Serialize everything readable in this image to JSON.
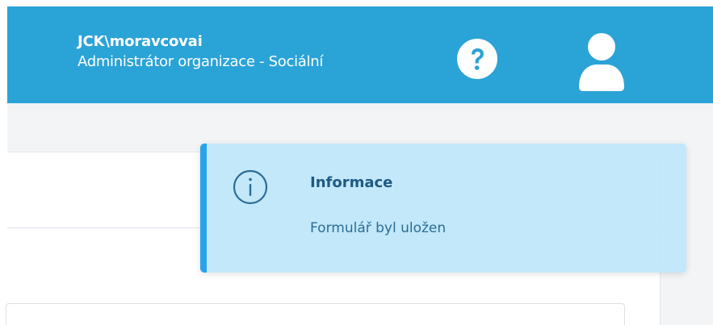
{
  "header": {
    "username": "JCK\\moravcovai",
    "role": "Administrátor organizace - Sociální",
    "help_icon": "help-question-icon",
    "user_icon": "user-profile-icon",
    "background_color": "#2aa3d7"
  },
  "toast": {
    "icon": "info-circle-icon",
    "title": "Informace",
    "message": "Formulář byl uložen",
    "accent_color": "#29a3ea",
    "background_color": "#bde6fa"
  }
}
